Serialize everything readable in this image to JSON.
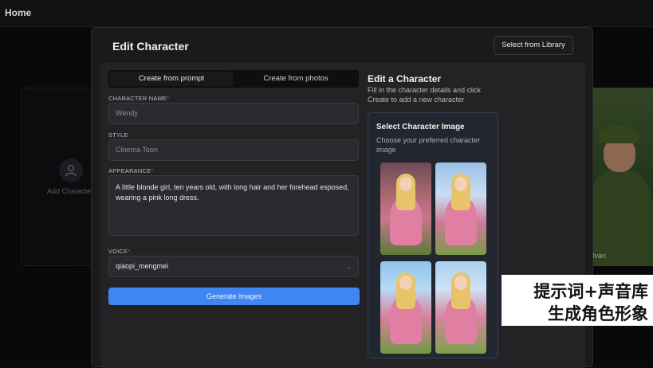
{
  "app": {
    "home_label": "Home"
  },
  "background": {
    "add_card_label": "Add Character",
    "photo_name": "Ivan"
  },
  "modal": {
    "title": "Edit Character",
    "library_button": "Select from Library",
    "tabs": [
      {
        "label": "Create from prompt",
        "active": true
      },
      {
        "label": "Create from photos",
        "active": false
      }
    ],
    "fields": {
      "name": {
        "label": "CHARACTER NAME",
        "required": true,
        "placeholder": "Wendy"
      },
      "style": {
        "label": "STYLE",
        "required": false,
        "value": "Cinema Toon"
      },
      "appearance": {
        "label": "APPEARANCE",
        "required": true,
        "value": "A little blonde girl, ten years old, with long hair and her forehead esposed, wearing a pink long dress."
      },
      "voice": {
        "label": "VOICE",
        "required": true,
        "value": "qiaopi_mengmei"
      }
    },
    "generate_button": "Generate images",
    "right": {
      "title": "Edit a Character",
      "description": "Fill in the character details and click Create to add a new character",
      "image_card_title": "Select Character Image",
      "image_card_desc": "Choose your preferred character image"
    }
  },
  "caption": {
    "line1": "提示词+声音库",
    "line2": "生成角色形象"
  },
  "colors": {
    "accent": "#3f86f3",
    "required": "#e04b4b",
    "modal_bg": "#1a1a1c"
  }
}
